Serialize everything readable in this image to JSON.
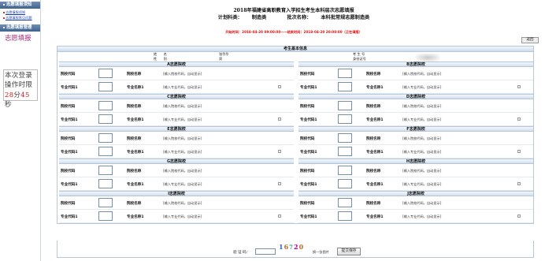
{
  "sidebar": {
    "header1": "志愿填报须知",
    "links": [
      "志愿填报须知",
      "志愿填报常见问题"
    ],
    "header2": "志愿填报管理",
    "title": "志愿填报",
    "timer": {
      "line1": "本次登录",
      "line2": "操作时限",
      "minutes": "28",
      "min_unit": "分",
      "seconds": "45",
      "sec_unit": "秒"
    }
  },
  "header": {
    "title": "2018年福建省高职教育入学招生考生本科层次志愿填报",
    "plan_label": "计划科类：",
    "plan_value": "制造类",
    "batch_label": "批次名称：",
    "batch_value": "本科批常规志愿制造类",
    "time_line": "开始时间：2018-04-20 09:00:00——结束时间：2018-04-20 20:00:00（正在填报）"
  },
  "back_button": "返回",
  "basic_info": {
    "title": "考生基本信息",
    "name_label": "姓　　名",
    "name_value": "张华华",
    "gender_label": "性　　别",
    "gender_value": "男",
    "exam_no_label": "考 生 号",
    "id_label": "身份证号"
  },
  "blocks": [
    {
      "title": "A志愿院校"
    },
    {
      "title": "B志愿院校"
    },
    {
      "title": "C志愿院校"
    },
    {
      "title": "D志愿院校"
    },
    {
      "title": "E志愿院校"
    },
    {
      "title": "F志愿院校"
    },
    {
      "title": "G志愿院校"
    },
    {
      "title": "H志愿院校"
    },
    {
      "title": "I志愿院校"
    },
    {
      "title": "J志愿院校"
    }
  ],
  "row_labels": {
    "school_code": "院校代码",
    "school_name": "院校名称",
    "school_hint": "[输入院校代码，自动显示]",
    "major_code": "专业代码1",
    "major_name": "专业名称1",
    "major_hint": "[输入专业代码，自动显示]"
  },
  "footer": {
    "captcha_label": "验 证 码：",
    "captcha_chars": [
      "1",
      "6",
      "7",
      "2",
      "0"
    ],
    "refresh_text": "换一张图片",
    "submit": "提交保存"
  }
}
